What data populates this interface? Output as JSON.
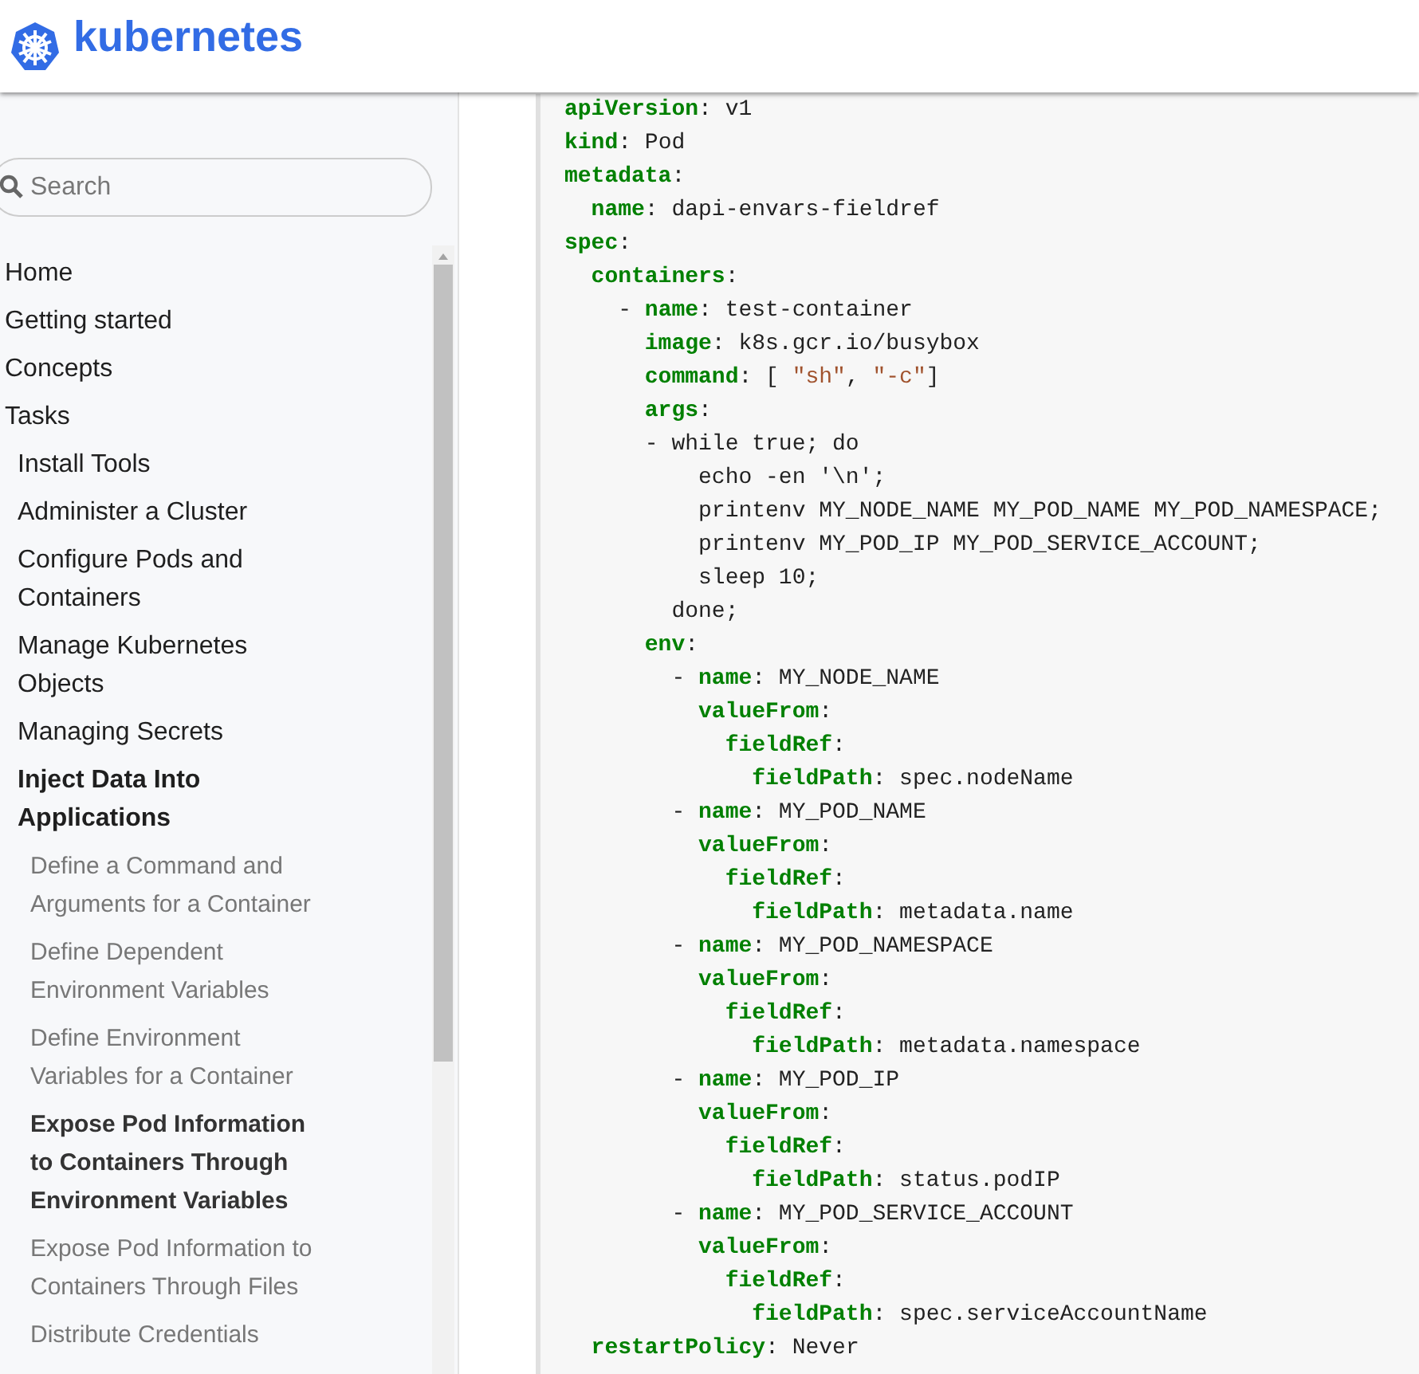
{
  "header": {
    "brand": "kubernetes"
  },
  "sidebar": {
    "search": {
      "placeholder": "Search"
    },
    "items": [
      {
        "label": "Home",
        "selected": false,
        "active": false
      },
      {
        "label": "Getting started",
        "selected": false,
        "active": false
      },
      {
        "label": "Concepts",
        "selected": false,
        "active": false
      },
      {
        "label": "Tasks",
        "selected": false,
        "active": false,
        "children": [
          {
            "label": "Install Tools",
            "selected": false,
            "active": false
          },
          {
            "label": "Administer a Cluster",
            "selected": false,
            "active": false
          },
          {
            "label": "Configure Pods and Containers",
            "selected": false,
            "active": false
          },
          {
            "label": "Manage Kubernetes Objects",
            "selected": false,
            "active": false
          },
          {
            "label": "Managing Secrets",
            "selected": false,
            "active": false
          },
          {
            "label": "Inject Data Into Applications",
            "selected": false,
            "active": true,
            "children": [
              {
                "label": "Define a Command and Arguments for a Container",
                "selected": false,
                "active": false
              },
              {
                "label": "Define Dependent Environment Variables",
                "selected": false,
                "active": false
              },
              {
                "label": "Define Environment Variables for a Container",
                "selected": false,
                "active": false
              },
              {
                "label": "Expose Pod Information to Containers Through Environment Variables",
                "selected": true,
                "active": false
              },
              {
                "label": "Expose Pod Information to Containers Through Files",
                "selected": false,
                "active": false
              },
              {
                "label": "Distribute Credentials",
                "selected": false,
                "active": false
              }
            ]
          }
        ]
      }
    ]
  },
  "code": {
    "lines": [
      [
        {
          "kind": "key",
          "text": "apiVersion"
        },
        {
          "kind": "text",
          "text": ": v1"
        }
      ],
      [
        {
          "kind": "key",
          "text": "kind"
        },
        {
          "kind": "text",
          "text": ": Pod"
        }
      ],
      [
        {
          "kind": "key",
          "text": "metadata"
        },
        {
          "kind": "text",
          "text": ":"
        }
      ],
      [
        {
          "kind": "key",
          "text": "  name"
        },
        {
          "kind": "text",
          "text": ": dapi-envars-fieldref"
        }
      ],
      [
        {
          "kind": "key",
          "text": "spec"
        },
        {
          "kind": "text",
          "text": ":"
        }
      ],
      [
        {
          "kind": "key",
          "text": "  containers"
        },
        {
          "kind": "text",
          "text": ":"
        }
      ],
      [
        {
          "kind": "text",
          "text": "    - "
        },
        {
          "kind": "key",
          "text": "name"
        },
        {
          "kind": "text",
          "text": ": test-container"
        }
      ],
      [
        {
          "kind": "key",
          "text": "      image"
        },
        {
          "kind": "text",
          "text": ": k8s.gcr.io/busybox"
        }
      ],
      [
        {
          "kind": "key",
          "text": "      command"
        },
        {
          "kind": "text",
          "text": ": [ "
        },
        {
          "kind": "string",
          "text": "\"sh\""
        },
        {
          "kind": "text",
          "text": ", "
        },
        {
          "kind": "string",
          "text": "\"-c\""
        },
        {
          "kind": "text",
          "text": "]"
        }
      ],
      [
        {
          "kind": "key",
          "text": "      args"
        },
        {
          "kind": "text",
          "text": ":"
        }
      ],
      [
        {
          "kind": "text",
          "text": "      - while true; do"
        }
      ],
      [
        {
          "kind": "text",
          "text": "          echo -en '\\n';"
        }
      ],
      [
        {
          "kind": "text",
          "text": "          printenv MY_NODE_NAME MY_POD_NAME MY_POD_NAMESPACE;"
        }
      ],
      [
        {
          "kind": "text",
          "text": "          printenv MY_POD_IP MY_POD_SERVICE_ACCOUNT;"
        }
      ],
      [
        {
          "kind": "text",
          "text": "          sleep 10;"
        }
      ],
      [
        {
          "kind": "text",
          "text": "        done;"
        }
      ],
      [
        {
          "kind": "key",
          "text": "      env"
        },
        {
          "kind": "text",
          "text": ":"
        }
      ],
      [
        {
          "kind": "text",
          "text": "        - "
        },
        {
          "kind": "key",
          "text": "name"
        },
        {
          "kind": "text",
          "text": ": MY_NODE_NAME"
        }
      ],
      [
        {
          "kind": "key",
          "text": "          valueFrom"
        },
        {
          "kind": "text",
          "text": ":"
        }
      ],
      [
        {
          "kind": "key",
          "text": "            fieldRef"
        },
        {
          "kind": "text",
          "text": ":"
        }
      ],
      [
        {
          "kind": "key",
          "text": "              fieldPath"
        },
        {
          "kind": "text",
          "text": ": spec.nodeName"
        }
      ],
      [
        {
          "kind": "text",
          "text": "        - "
        },
        {
          "kind": "key",
          "text": "name"
        },
        {
          "kind": "text",
          "text": ": MY_POD_NAME"
        }
      ],
      [
        {
          "kind": "key",
          "text": "          valueFrom"
        },
        {
          "kind": "text",
          "text": ":"
        }
      ],
      [
        {
          "kind": "key",
          "text": "            fieldRef"
        },
        {
          "kind": "text",
          "text": ":"
        }
      ],
      [
        {
          "kind": "key",
          "text": "              fieldPath"
        },
        {
          "kind": "text",
          "text": ": metadata.name"
        }
      ],
      [
        {
          "kind": "text",
          "text": "        - "
        },
        {
          "kind": "key",
          "text": "name"
        },
        {
          "kind": "text",
          "text": ": MY_POD_NAMESPACE"
        }
      ],
      [
        {
          "kind": "key",
          "text": "          valueFrom"
        },
        {
          "kind": "text",
          "text": ":"
        }
      ],
      [
        {
          "kind": "key",
          "text": "            fieldRef"
        },
        {
          "kind": "text",
          "text": ":"
        }
      ],
      [
        {
          "kind": "key",
          "text": "              fieldPath"
        },
        {
          "kind": "text",
          "text": ": metadata.namespace"
        }
      ],
      [
        {
          "kind": "text",
          "text": "        - "
        },
        {
          "kind": "key",
          "text": "name"
        },
        {
          "kind": "text",
          "text": ": MY_POD_IP"
        }
      ],
      [
        {
          "kind": "key",
          "text": "          valueFrom"
        },
        {
          "kind": "text",
          "text": ":"
        }
      ],
      [
        {
          "kind": "key",
          "text": "            fieldRef"
        },
        {
          "kind": "text",
          "text": ":"
        }
      ],
      [
        {
          "kind": "key",
          "text": "              fieldPath"
        },
        {
          "kind": "text",
          "text": ": status.podIP"
        }
      ],
      [
        {
          "kind": "text",
          "text": "        - "
        },
        {
          "kind": "key",
          "text": "name"
        },
        {
          "kind": "text",
          "text": ": MY_POD_SERVICE_ACCOUNT"
        }
      ],
      [
        {
          "kind": "key",
          "text": "          valueFrom"
        },
        {
          "kind": "text",
          "text": ":"
        }
      ],
      [
        {
          "kind": "key",
          "text": "            fieldRef"
        },
        {
          "kind": "text",
          "text": ":"
        }
      ],
      [
        {
          "kind": "key",
          "text": "              fieldPath"
        },
        {
          "kind": "text",
          "text": ": spec.serviceAccountName"
        }
      ],
      [
        {
          "kind": "key",
          "text": "  restartPolicy"
        },
        {
          "kind": "text",
          "text": ": Never"
        }
      ]
    ]
  }
}
